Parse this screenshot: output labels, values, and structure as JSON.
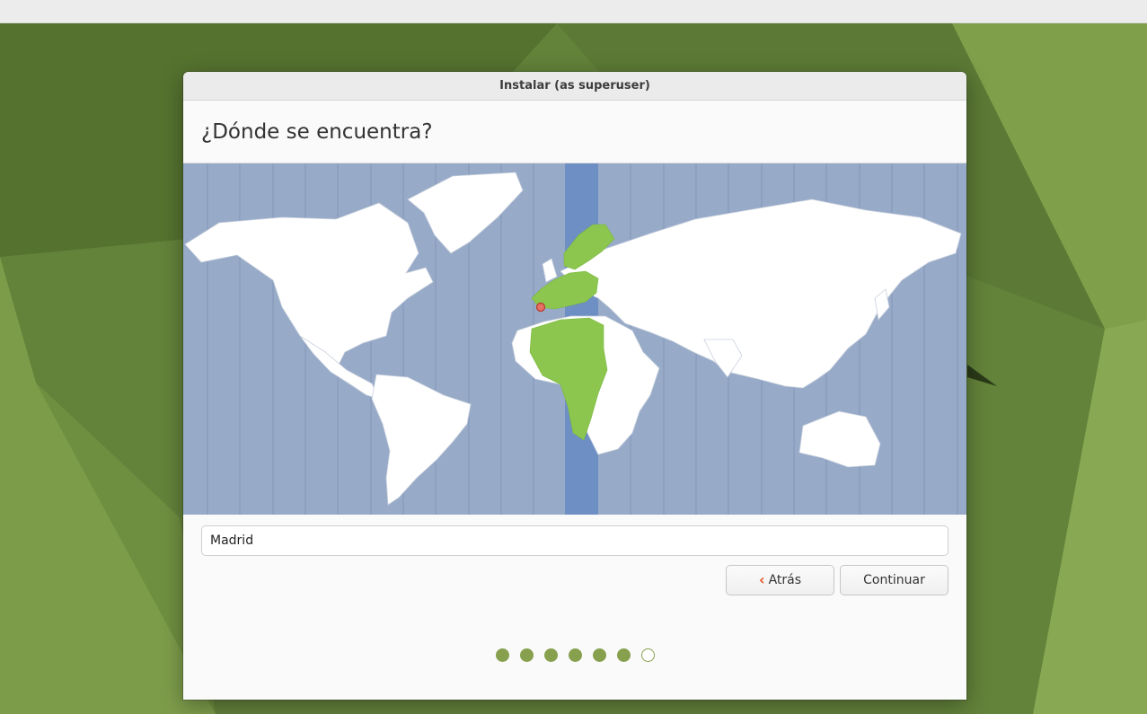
{
  "window": {
    "title": "Instalar (as superuser)",
    "heading": "¿Dónde se encuentra?"
  },
  "location": {
    "value": "Madrid"
  },
  "buttons": {
    "back_label": "Atrás",
    "back_icon": "chevron-left-icon",
    "continue_label": "Continuar"
  },
  "progress": {
    "total_steps": 7,
    "completed_steps": 6
  },
  "colors": {
    "accent_orange": "#e95420",
    "selected_timezone": "#8cc64f",
    "ocean": "#97aac8",
    "timezone_band": "#6d8fc4",
    "progress_dot": "#87a04e"
  }
}
